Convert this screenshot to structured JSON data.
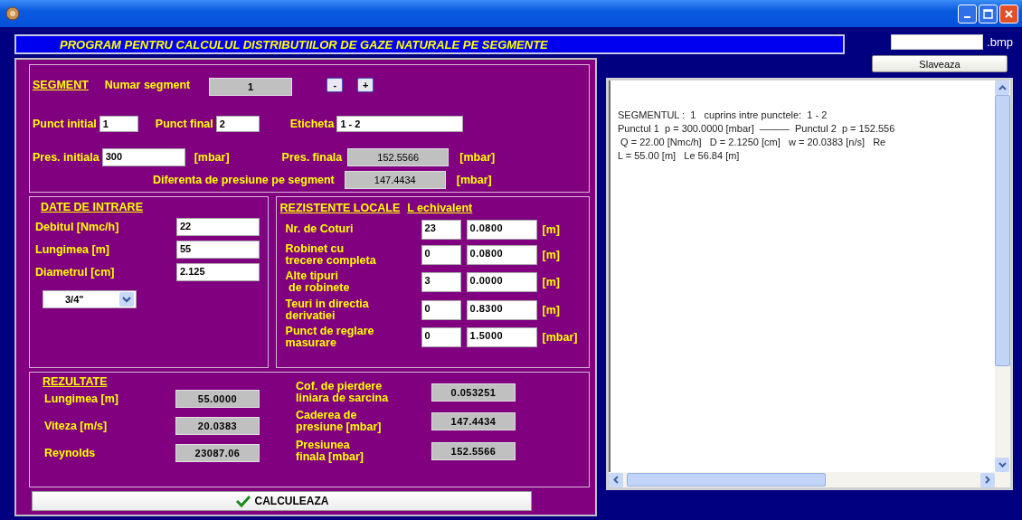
{
  "banner": {
    "title": "PROGRAM PENTRU CALCULUL DISTRIBUTIILOR DE GAZE NATURALE PE SEGMENTE"
  },
  "segment": {
    "heading": "SEGMENT",
    "number_label": "Numar segment",
    "number": "1",
    "minus": "-",
    "plus": "+",
    "initial_point_label": "Punct initial",
    "initial_point": "1",
    "final_point_label": "Punct final",
    "final_point": "2",
    "tag_label": "Eticheta",
    "tag": "1 - 2",
    "initial_pressure_label": "Pres. initiala",
    "initial_pressure": "300",
    "initial_pressure_unit": "[mbar]",
    "final_pressure_label": "Pres. finala",
    "final_pressure": "152.5566",
    "final_pressure_unit": "[mbar]",
    "difference_label": "Diferenta de presiune pe segment",
    "difference": "147.4434",
    "difference_unit": "[mbar]"
  },
  "inputs": {
    "heading": "DATE DE INTRARE",
    "fields": [
      {
        "label": "Debitul [Nmc/h]",
        "value": "22"
      },
      {
        "label": "Lungimea [m]",
        "value": "55"
      },
      {
        "label": "Diametrul [cm]",
        "value": "2.125"
      }
    ],
    "dropdown": {
      "value": "3/4\""
    }
  },
  "local_resistances": {
    "heading": "REZISTENTE LOCALE",
    "subheading": "L echivalent",
    "rows": [
      {
        "label": "Nr. de Coturi",
        "count": "23",
        "value": "0.0800",
        "unit": "[m]"
      },
      {
        "label": "Robinet cu\ntrecere completa",
        "count": "0",
        "value": "0.0800",
        "unit": "[m]"
      },
      {
        "label": "Alte tipuri\n de robinete",
        "count": "3",
        "value": "0.0000",
        "unit": "[m]"
      },
      {
        "label": "Teuri in directia\nderivatiei",
        "count": "0",
        "value": "0.8300",
        "unit": "[m]"
      },
      {
        "label": "Punct de reglare\nmasurare",
        "count": "0",
        "value": "1.5000",
        "unit": "[mbar]"
      }
    ]
  },
  "results": {
    "heading": "REZULTATE",
    "left": [
      {
        "label": "Lungimea [m]",
        "value": "55.0000"
      },
      {
        "label": "Viteza [m/s]",
        "value": "20.0383"
      },
      {
        "label": "Reynolds",
        "value": "23087.06"
      }
    ],
    "right": [
      {
        "label": "Cof. de pierdere\nliniara de sarcina",
        "value": "0.053251"
      },
      {
        "label": "Caderea de\npresiune [mbar]",
        "value": "147.4434"
      },
      {
        "label": "Presiunea\nfinala [mbar]",
        "value": "152.5566"
      }
    ]
  },
  "calculate_button": "CALCULEAZA",
  "export": {
    "extension": ".bmp",
    "save_button": "Slaveaza"
  },
  "report": {
    "lines": [
      "SEGMENTUL :  1   cuprins intre punctele:  1 - 2",
      "Punctul 1  p = 300.0000 [mbar]  ———  Punctul 2  p = 152.556",
      " Q = 22.00 [Nmc/h]   D = 2.1250 [cm]   w = 20.0383 [n/s]   Re",
      "L = 55.00 [m]   Le 56.84 [m]"
    ]
  }
}
